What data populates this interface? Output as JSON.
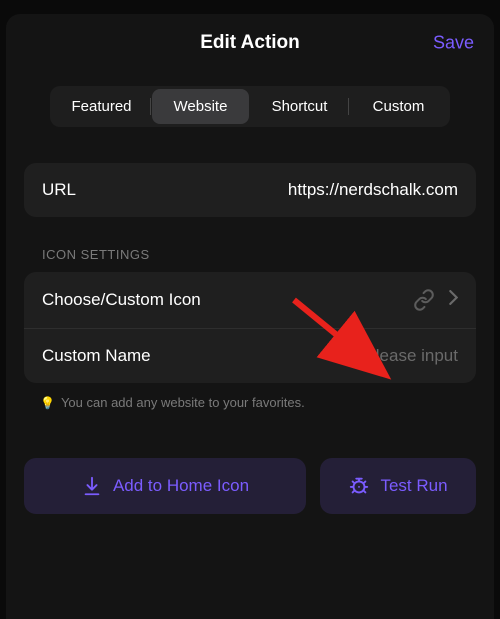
{
  "header": {
    "title": "Edit Action",
    "save": "Save"
  },
  "tabs": {
    "items": [
      {
        "label": "Featured"
      },
      {
        "label": "Website"
      },
      {
        "label": "Shortcut"
      },
      {
        "label": "Custom"
      }
    ]
  },
  "url_row": {
    "label": "URL",
    "value": "https://nerdschalk.com"
  },
  "icon_settings": {
    "header": "ICON SETTINGS",
    "choose_label": "Choose/Custom Icon",
    "custom_name_label": "Custom Name",
    "custom_name_placeholder": "Please input"
  },
  "hint": {
    "icon": "💡",
    "text": "You can add any website to your favorites."
  },
  "buttons": {
    "add_home": "Add to Home Icon",
    "test_run": "Test Run"
  }
}
